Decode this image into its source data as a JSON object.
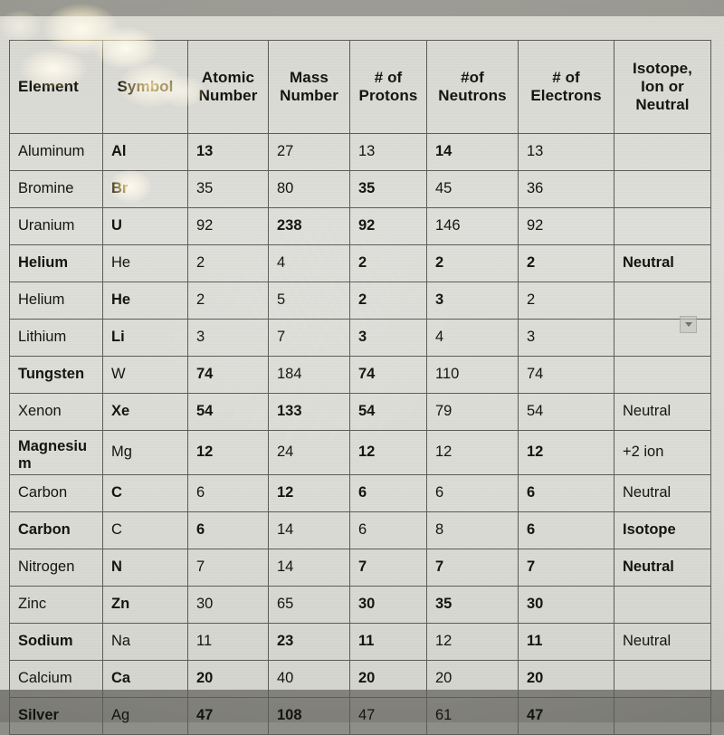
{
  "document": {
    "title": "Atomic Structure Worksheet Table",
    "kind": "photographed-screen-table"
  },
  "table": {
    "columns": [
      {
        "key": "element",
        "label": "Element"
      },
      {
        "key": "symbol",
        "label": "Symbol"
      },
      {
        "key": "atomic",
        "label": "Atomic Number"
      },
      {
        "key": "mass",
        "label": "Mass Number"
      },
      {
        "key": "protons",
        "label": "# of Protons"
      },
      {
        "key": "neutrons",
        "label": "#of Neutrons"
      },
      {
        "key": "electrons",
        "label": "# of Electrons"
      },
      {
        "key": "isotope",
        "label": "Isotope, Ion or Neutral"
      }
    ],
    "column_label_lines": [
      [
        "Element"
      ],
      [
        "Symbol"
      ],
      [
        "Atomic",
        "Number"
      ],
      [
        "Mass",
        "Number"
      ],
      [
        "# of",
        "Protons"
      ],
      [
        "#of",
        "Neutrons"
      ],
      [
        "# of",
        "Electrons"
      ],
      [
        "Isotope,",
        "Ion or",
        "Neutral"
      ]
    ],
    "rows": [
      {
        "element": "Aluminum",
        "element_bold": false,
        "symbol": "Al",
        "symbol_bold": true,
        "atomic": "13",
        "atomic_bold": true,
        "mass": "27",
        "mass_bold": false,
        "protons": "13",
        "protons_bold": false,
        "neutrons": "14",
        "neutrons_bold": true,
        "electrons": "13",
        "electrons_bold": false,
        "isotope": "",
        "isotope_bold": false
      },
      {
        "element": "Bromine",
        "element_bold": false,
        "symbol": "Br",
        "symbol_bold": true,
        "atomic": "35",
        "atomic_bold": false,
        "mass": "80",
        "mass_bold": false,
        "protons": "35",
        "protons_bold": true,
        "neutrons": "45",
        "neutrons_bold": false,
        "electrons": "36",
        "electrons_bold": false,
        "isotope": "",
        "isotope_bold": false
      },
      {
        "element": "Uranium",
        "element_bold": false,
        "symbol": "U",
        "symbol_bold": true,
        "atomic": "92",
        "atomic_bold": false,
        "mass": "238",
        "mass_bold": true,
        "protons": "92",
        "protons_bold": true,
        "neutrons": "146",
        "neutrons_bold": false,
        "electrons": "92",
        "electrons_bold": false,
        "isotope": "",
        "isotope_bold": false
      },
      {
        "element": "Helium",
        "element_bold": true,
        "symbol": "He",
        "symbol_bold": false,
        "atomic": "2",
        "atomic_bold": false,
        "mass": "4",
        "mass_bold": false,
        "protons": "2",
        "protons_bold": true,
        "neutrons": "2",
        "neutrons_bold": true,
        "electrons": "2",
        "electrons_bold": true,
        "isotope": "Neutral",
        "isotope_bold": true
      },
      {
        "element": "Helium",
        "element_bold": false,
        "symbol": "He",
        "symbol_bold": true,
        "atomic": "2",
        "atomic_bold": false,
        "mass": "5",
        "mass_bold": false,
        "protons": "2",
        "protons_bold": true,
        "neutrons": "3",
        "neutrons_bold": true,
        "electrons": "2",
        "electrons_bold": false,
        "isotope": "",
        "isotope_bold": false
      },
      {
        "element": "Lithium",
        "element_bold": false,
        "symbol": "Li",
        "symbol_bold": true,
        "atomic": "3",
        "atomic_bold": false,
        "mass": "7",
        "mass_bold": false,
        "protons": "3",
        "protons_bold": true,
        "neutrons": "4",
        "neutrons_bold": false,
        "electrons": "3",
        "electrons_bold": false,
        "isotope": "",
        "isotope_bold": false
      },
      {
        "element": "Tungsten",
        "element_bold": true,
        "symbol": "W",
        "symbol_bold": false,
        "atomic": "74",
        "atomic_bold": true,
        "mass": "184",
        "mass_bold": false,
        "protons": "74",
        "protons_bold": true,
        "neutrons": "110",
        "neutrons_bold": false,
        "electrons": "74",
        "electrons_bold": false,
        "isotope": "",
        "isotope_bold": false
      },
      {
        "element": "Xenon",
        "element_bold": false,
        "symbol": "Xe",
        "symbol_bold": true,
        "atomic": "54",
        "atomic_bold": true,
        "mass": "133",
        "mass_bold": true,
        "protons": "54",
        "protons_bold": true,
        "neutrons": "79",
        "neutrons_bold": false,
        "electrons": "54",
        "electrons_bold": false,
        "isotope": "Neutral",
        "isotope_bold": false
      },
      {
        "element": "Magnesiu m",
        "element_bold": true,
        "symbol": "Mg",
        "symbol_bold": false,
        "atomic": "12",
        "atomic_bold": true,
        "mass": "24",
        "mass_bold": false,
        "protons": "12",
        "protons_bold": true,
        "neutrons": "12",
        "neutrons_bold": false,
        "electrons": "12",
        "electrons_bold": true,
        "isotope": "+2 ion",
        "isotope_bold": false
      },
      {
        "element": "Carbon",
        "element_bold": false,
        "symbol": "C",
        "symbol_bold": true,
        "atomic": "6",
        "atomic_bold": false,
        "mass": "12",
        "mass_bold": true,
        "protons": "6",
        "protons_bold": true,
        "neutrons": "6",
        "neutrons_bold": false,
        "electrons": "6",
        "electrons_bold": true,
        "isotope": "Neutral",
        "isotope_bold": false
      },
      {
        "element": "Carbon",
        "element_bold": true,
        "symbol": "C",
        "symbol_bold": false,
        "atomic": "6",
        "atomic_bold": true,
        "mass": "14",
        "mass_bold": false,
        "protons": "6",
        "protons_bold": false,
        "neutrons": "8",
        "neutrons_bold": false,
        "electrons": "6",
        "electrons_bold": true,
        "isotope": "Isotope",
        "isotope_bold": true
      },
      {
        "element": "Nitrogen",
        "element_bold": false,
        "symbol": "N",
        "symbol_bold": true,
        "atomic": "7",
        "atomic_bold": false,
        "mass": "14",
        "mass_bold": false,
        "protons": "7",
        "protons_bold": true,
        "neutrons": "7",
        "neutrons_bold": true,
        "electrons": "7",
        "electrons_bold": true,
        "isotope": "Neutral",
        "isotope_bold": true
      },
      {
        "element": "Zinc",
        "element_bold": false,
        "symbol": "Zn",
        "symbol_bold": true,
        "atomic": "30",
        "atomic_bold": false,
        "mass": "65",
        "mass_bold": false,
        "protons": "30",
        "protons_bold": true,
        "neutrons": "35",
        "neutrons_bold": true,
        "electrons": "30",
        "electrons_bold": true,
        "isotope": "",
        "isotope_bold": false
      },
      {
        "element": "Sodium",
        "element_bold": true,
        "symbol": "Na",
        "symbol_bold": false,
        "atomic": "11",
        "atomic_bold": false,
        "mass": "23",
        "mass_bold": true,
        "protons": "11",
        "protons_bold": true,
        "neutrons": "12",
        "neutrons_bold": false,
        "electrons": "11",
        "electrons_bold": true,
        "isotope": "Neutral",
        "isotope_bold": false
      },
      {
        "element": "Calcium",
        "element_bold": false,
        "symbol": "Ca",
        "symbol_bold": true,
        "atomic": "20",
        "atomic_bold": true,
        "mass": "40",
        "mass_bold": false,
        "protons": "20",
        "protons_bold": true,
        "neutrons": "20",
        "neutrons_bold": false,
        "electrons": "20",
        "electrons_bold": true,
        "isotope": "",
        "isotope_bold": false
      },
      {
        "element": "Silver",
        "element_bold": true,
        "symbol": "Ag",
        "symbol_bold": false,
        "atomic": "47",
        "atomic_bold": true,
        "mass": "108",
        "mass_bold": true,
        "protons": "47",
        "protons_bold": false,
        "neutrons": "61",
        "neutrons_bold": false,
        "electrons": "47",
        "electrons_bold": true,
        "isotope": "",
        "isotope_bold": false
      }
    ]
  },
  "artifacts": {
    "scroll_arrow_glyph": "▼"
  },
  "colors": {
    "page_background": "#8e8e88",
    "sheet_background": "#dcdcd6",
    "grid_line": "#5c5c58",
    "text": "#15150f",
    "glare": "#ffe296"
  }
}
